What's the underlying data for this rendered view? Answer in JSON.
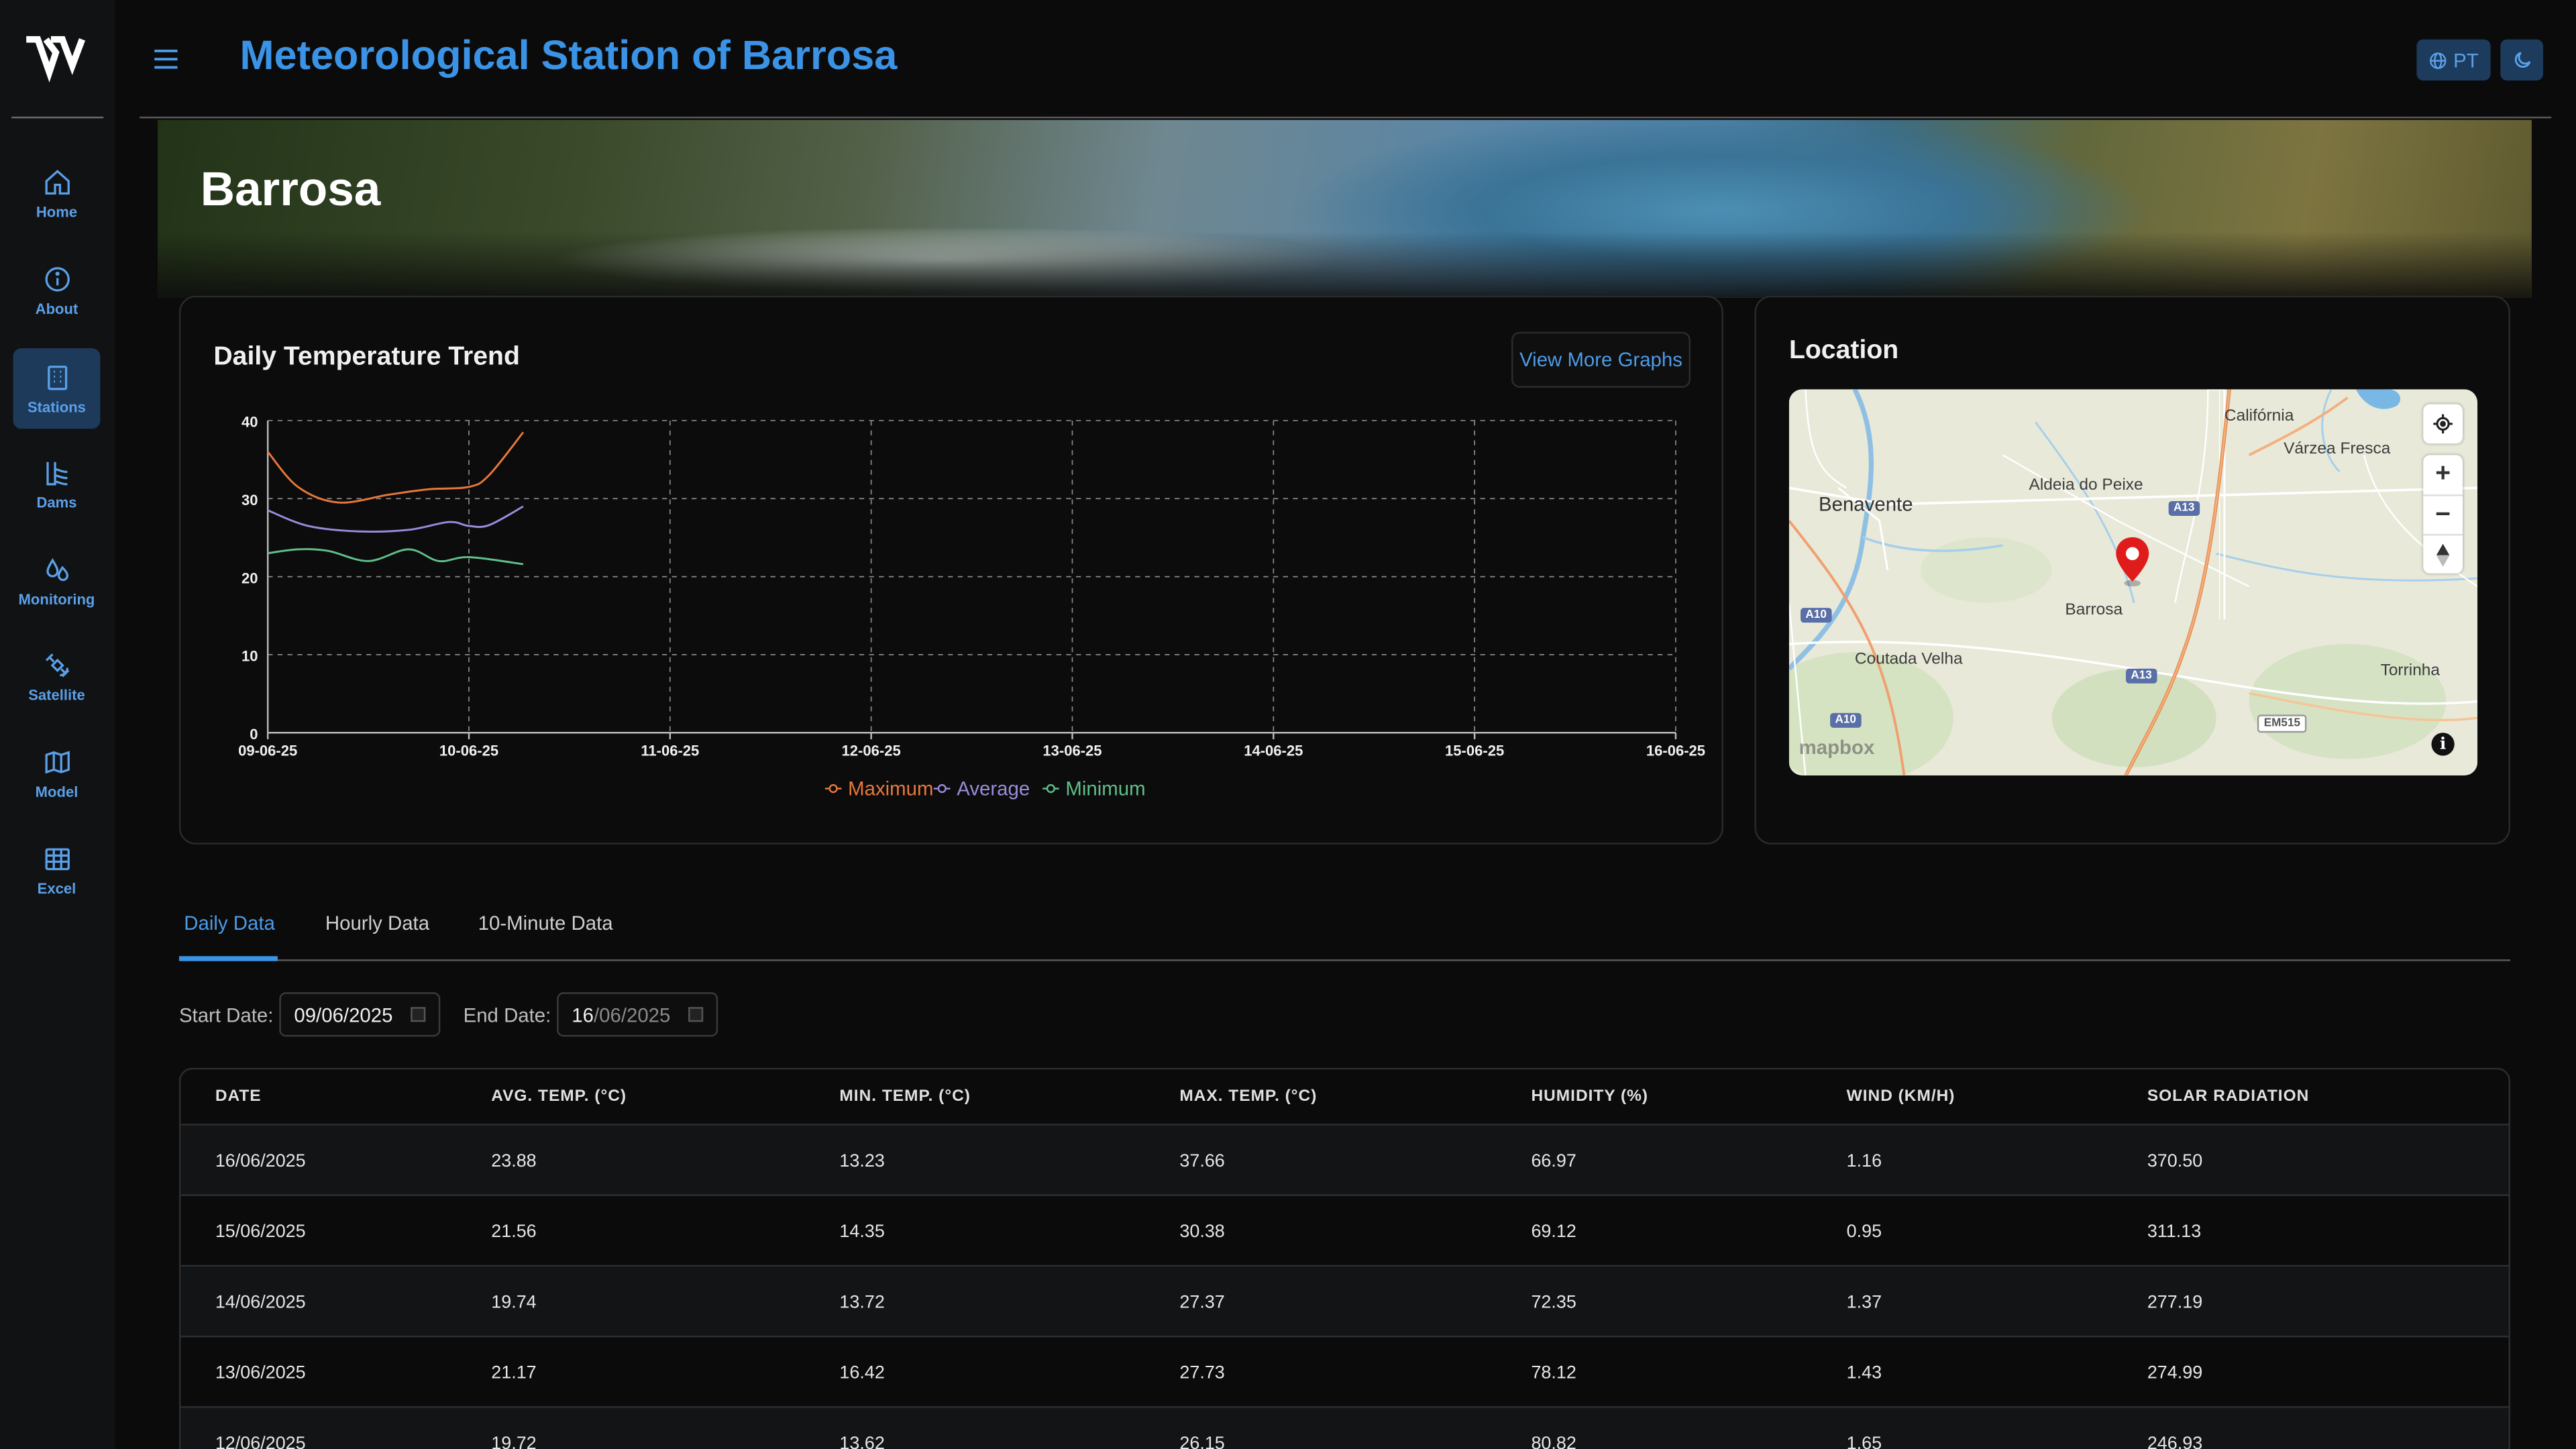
{
  "header": {
    "title": "Meteorological Station of Barrosa",
    "lang_label": "PT"
  },
  "sidebar": {
    "items": [
      {
        "label": "Home",
        "icon": "home-icon"
      },
      {
        "label": "About",
        "icon": "info-icon"
      },
      {
        "label": "Stations",
        "icon": "building-icon",
        "active": true
      },
      {
        "label": "Dams",
        "icon": "dam-icon"
      },
      {
        "label": "Monitoring",
        "icon": "droplets-icon"
      },
      {
        "label": "Satellite",
        "icon": "satellite-icon"
      },
      {
        "label": "Model",
        "icon": "map-icon"
      },
      {
        "label": "Excel",
        "icon": "table-icon"
      }
    ]
  },
  "banner": {
    "title": "Barrosa"
  },
  "chart_card": {
    "title": "Daily Temperature Trend",
    "button": "View More Graphs"
  },
  "chart_data": {
    "type": "line",
    "title": "Daily Temperature Trend",
    "x": [
      "09-06-25",
      "10-06-25",
      "11-06-25",
      "12-06-25",
      "13-06-25",
      "14-06-25",
      "15-06-25",
      "16-06-25"
    ],
    "ylim": [
      0,
      40
    ],
    "yticks": [
      "0",
      "10",
      "20",
      "30",
      "40"
    ],
    "grid": true,
    "legend": "bottom",
    "series": [
      {
        "name": "Maximum",
        "color": "#e8783a",
        "points": [
          [
            0,
            36
          ],
          [
            0.15,
            31.5
          ],
          [
            0.35,
            29.5
          ],
          [
            0.6,
            30.5
          ],
          [
            0.8,
            31.2
          ],
          [
            1.0,
            31.5
          ],
          [
            1.1,
            33
          ],
          [
            1.27,
            38.5
          ]
        ]
      },
      {
        "name": "Average",
        "color": "#9b8bdc",
        "points": [
          [
            0,
            28.5
          ],
          [
            0.2,
            26.5
          ],
          [
            0.45,
            25.8
          ],
          [
            0.7,
            26
          ],
          [
            0.9,
            27
          ],
          [
            1.0,
            26.5
          ],
          [
            1.1,
            26.6
          ],
          [
            1.27,
            29
          ]
        ]
      },
      {
        "name": "Minimum",
        "color": "#5fbf8a",
        "points": [
          [
            0,
            23
          ],
          [
            0.15,
            23.5
          ],
          [
            0.3,
            23.3
          ],
          [
            0.5,
            22
          ],
          [
            0.7,
            23.5
          ],
          [
            0.85,
            22
          ],
          [
            1.0,
            22.5
          ],
          [
            1.27,
            21.6
          ]
        ]
      }
    ]
  },
  "location": {
    "title": "Location",
    "marker_label": "Barrosa",
    "labels": [
      "Califórnia",
      "Várzea Fresca",
      "Aldeia do Peixe",
      "Benavente",
      "Barrosa",
      "Coutada Velha",
      "Torrinha"
    ],
    "roads": [
      "A13",
      "A10",
      "A13",
      "A10",
      "EM515"
    ],
    "attribution": "mapbox"
  },
  "tabs": [
    {
      "label": "Daily Data",
      "active": true
    },
    {
      "label": "Hourly Data"
    },
    {
      "label": "10-Minute Data"
    }
  ],
  "filters": {
    "start_label": "Start Date:",
    "start_value": "09/06/2025",
    "end_label": "End Date:",
    "end_day": "16",
    "end_rest": "/06/2025"
  },
  "table": {
    "headers": [
      "DATE",
      "AVG. TEMP. (°C)",
      "MIN. TEMP. (°C)",
      "MAX. TEMP. (°C)",
      "HUMIDITY (%)",
      "WIND (KM/H)",
      "SOLAR RADIATION"
    ],
    "rows": [
      [
        "16/06/2025",
        "23.88",
        "13.23",
        "37.66",
        "66.97",
        "1.16",
        "370.50"
      ],
      [
        "15/06/2025",
        "21.56",
        "14.35",
        "30.38",
        "69.12",
        "0.95",
        "311.13"
      ],
      [
        "14/06/2025",
        "19.74",
        "13.72",
        "27.37",
        "72.35",
        "1.37",
        "277.19"
      ],
      [
        "13/06/2025",
        "21.17",
        "16.42",
        "27.73",
        "78.12",
        "1.43",
        "274.99"
      ],
      [
        "12/06/2025",
        "19.72",
        "13.62",
        "26.15",
        "80.82",
        "1.65",
        "246.93"
      ]
    ]
  }
}
